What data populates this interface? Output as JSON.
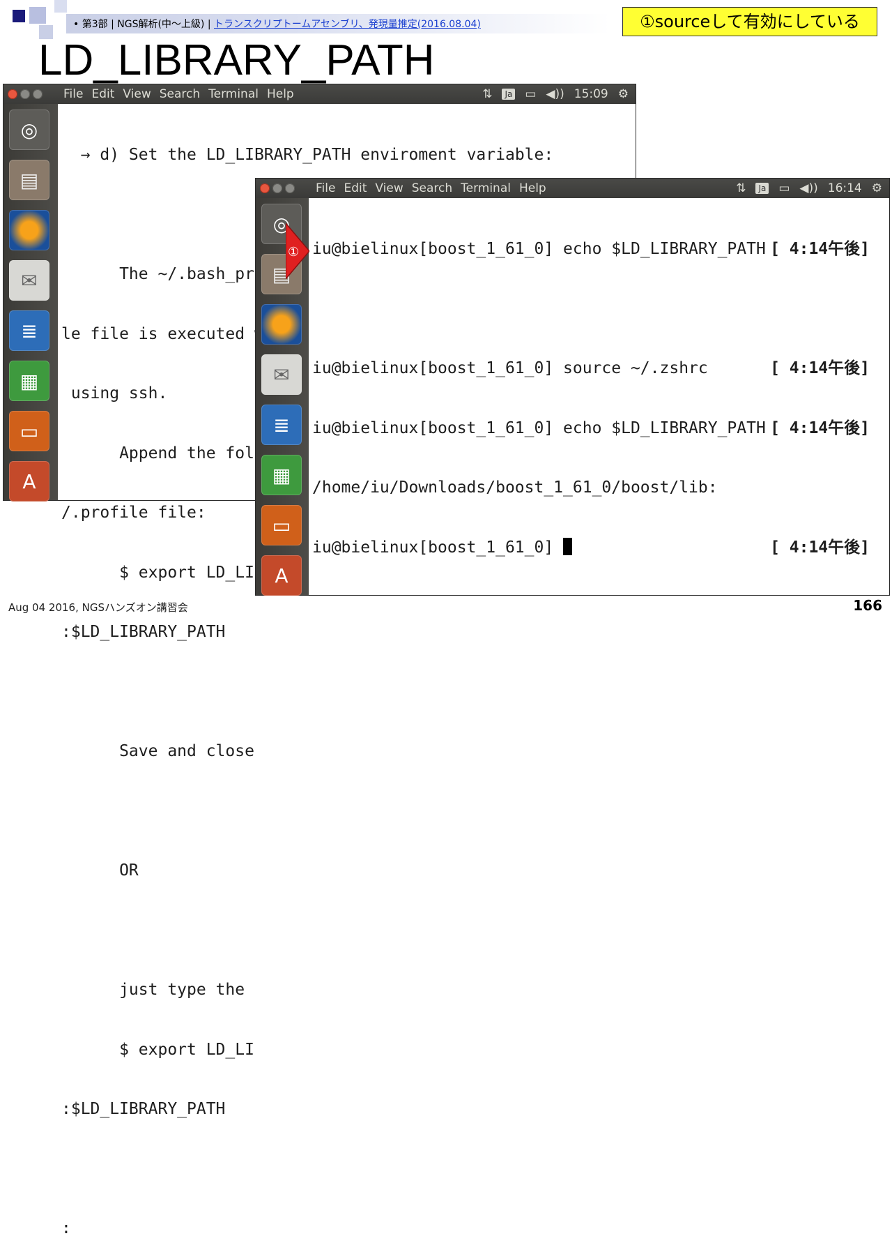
{
  "slide": {
    "bullet": "•",
    "breadcrumb_part": "第3部 | NGS解析(中〜上級) | ",
    "breadcrumb_link": "トランスクリプトームアセンブリ、発現量推定(2016.08.04)",
    "annotation": "①sourceして有効にしている",
    "title": "LD_LIBRARY_PATH",
    "footer_left": "Aug 04 2016, NGSハンズオン講習会",
    "page_number": "166",
    "marker": "①"
  },
  "back_window": {
    "menu": [
      "File",
      "Edit",
      "View",
      "Search",
      "Terminal",
      "Help"
    ],
    "clock": "15:09",
    "lines": [
      "  → d) Set the LD_LIBRARY_PATH enviroment variable:",
      "",
      "      The ~/.bash_profile ($HOME/.bash_profile) or ~/.profi",
      "le file is executed when you login using console or remotely",
      " using ssh.",
      "      Append the following line to ~/.bash_profile or ~",
      "/.profile file:",
      "      $ export LD_LIBRARY_PATH=/home/iu/Downloads/boost",
      ":$LD_LIBRARY_PATH",
      "",
      "      Save and close",
      "",
      "      OR",
      "",
      "      just type the",
      "      $ export LD_LI",
      ":$LD_LIBRARY_PATH",
      "",
      ":"
    ]
  },
  "front_window": {
    "menu": [
      "File",
      "Edit",
      "View",
      "Search",
      "Terminal",
      "Help"
    ],
    "clock": "16:14",
    "lines": [
      {
        "text": "iu@bielinux[boost_1_61_0] echo $LD_LIBRARY_PATH",
        "time": "[ 4:14午後]"
      },
      {
        "text": "",
        "time": ""
      },
      {
        "text": "iu@bielinux[boost_1_61_0] source ~/.zshrc",
        "time": "[ 4:14午後]"
      },
      {
        "text": "iu@bielinux[boost_1_61_0] echo $LD_LIBRARY_PATH",
        "time": "[ 4:14午後]"
      },
      {
        "text": "/home/iu/Downloads/boost_1_61_0/boost/lib:",
        "time": ""
      },
      {
        "text": "iu@bielinux[boost_1_61_0] ",
        "time": "[ 4:14午後]"
      }
    ]
  },
  "tray": {
    "keyboard": "Ja",
    "net": "⇅",
    "battery": "▭",
    "volume": "◀))",
    "settings": "⚙"
  },
  "launcher_icons": [
    "ubuntu-dash",
    "files",
    "firefox",
    "mail",
    "writer",
    "calc",
    "impress",
    "software-center",
    "trash"
  ],
  "colors": {
    "accent_red": "#e02020",
    "annotation_yellow": "#ffff33",
    "title_bar": "#3f3f3c"
  }
}
